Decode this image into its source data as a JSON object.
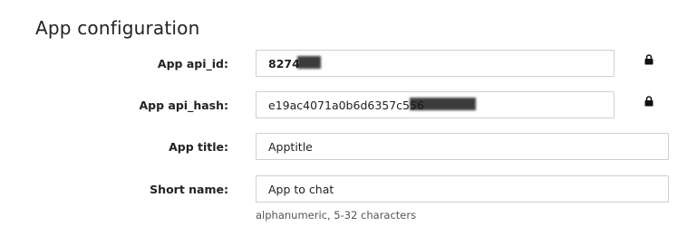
{
  "header": {
    "title": "App configuration"
  },
  "form": {
    "api_id": {
      "label": "App api_id:",
      "value": "8274",
      "locked": true
    },
    "api_hash": {
      "label": "App api_hash:",
      "value": "e19ac4071a0b6d6357c556",
      "locked": true
    },
    "app_title": {
      "label": "App title:",
      "value": "Apptitle"
    },
    "short_name": {
      "label": "Short name:",
      "value": "App to chat",
      "hint": "alphanumeric, 5-32 characters"
    }
  },
  "icons": {
    "lock": "lock-icon"
  },
  "colors": {
    "border": "#cfcfcf",
    "text": "#222222",
    "hint": "#555555"
  }
}
